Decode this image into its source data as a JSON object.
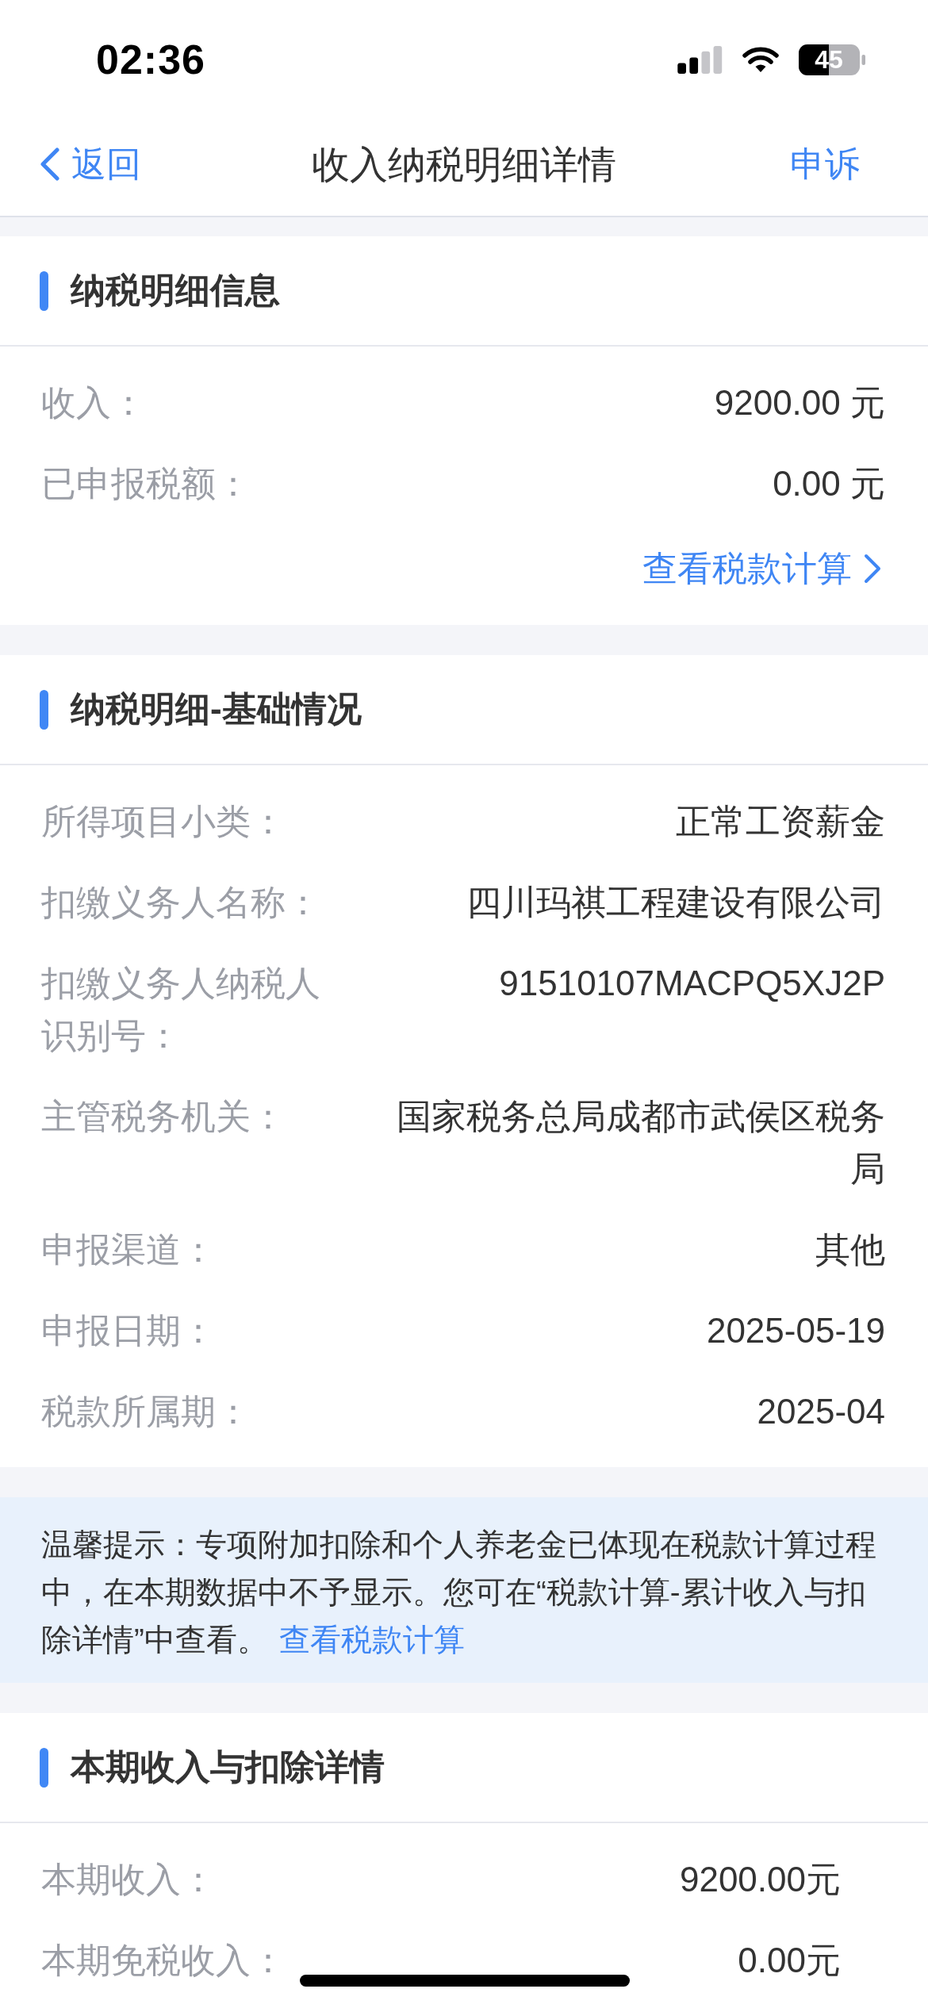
{
  "status_bar": {
    "time": "02:36",
    "battery": "45"
  },
  "nav_bar": {
    "back": "返回",
    "title": "收入纳税明细详情",
    "action": "申诉"
  },
  "sections": [
    {
      "kind": "details",
      "title": "纳税明细信息",
      "rows": [
        {
          "label": "收入：",
          "value": "9200.00 元"
        },
        {
          "label": "已申报税额：",
          "value": "0.00 元"
        }
      ],
      "link": "查看税款计算"
    },
    {
      "kind": "details",
      "title": "纳税明细-基础情况",
      "rows": [
        {
          "label": "所得项目小类：",
          "value": "正常工资薪金"
        },
        {
          "label": "扣缴义务人名称：",
          "value": "四川玛祺工程建设有限公司"
        },
        {
          "label": "扣缴义务人纳税人识别号：",
          "value": "91510107MACPQ5XJ2P"
        },
        {
          "label": "主管税务机关：",
          "value": "国家税务总局成都市武侯区税务局"
        },
        {
          "label": "申报渠道：",
          "value": "其他"
        },
        {
          "label": "申报日期：",
          "value": "2025-05-19"
        },
        {
          "label": "税款所属期：",
          "value": "2025-04"
        }
      ]
    },
    {
      "kind": "notice",
      "text": "温馨提示：专项附加扣除和个人养老金已体现在税款计算过程中，在本期数据中不予显示。您可在“税款计算-累计收入与扣除详情”中查看。",
      "link": "查看税款计算"
    },
    {
      "kind": "amounts",
      "title": "本期收入与扣除详情",
      "rows": [
        {
          "label": "本期收入：",
          "value": "9200.00元"
        },
        {
          "label": "本期免税收入：",
          "value": "0.00元"
        }
      ]
    }
  ]
}
